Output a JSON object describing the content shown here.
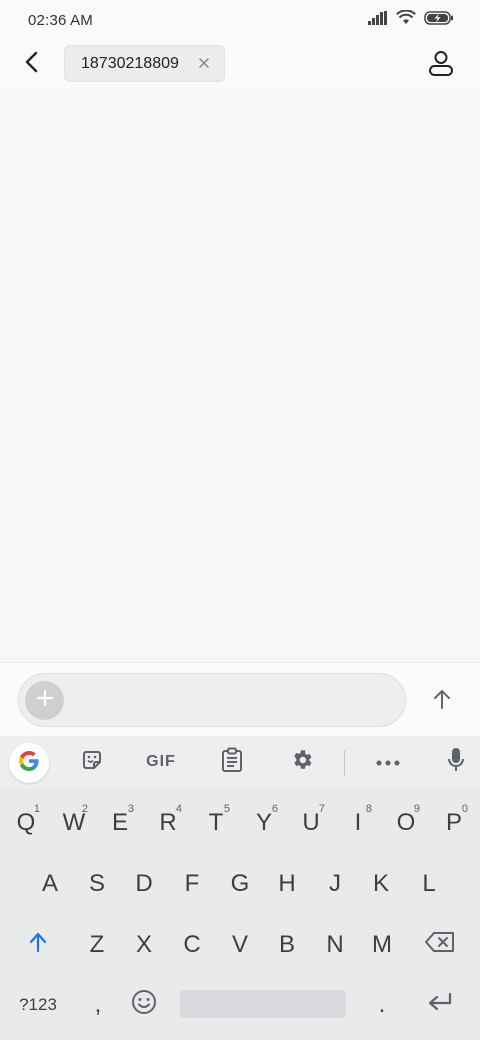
{
  "status_bar": {
    "time": "02:36 AM",
    "icons": [
      "signal-icon",
      "wifi-icon",
      "battery-charging-icon"
    ]
  },
  "header": {
    "back_icon": "back-arrow-icon",
    "recipient": "18730218809",
    "chip_close_icon": "close-icon",
    "contact_icon": "person-icon"
  },
  "compose": {
    "attach_icon": "plus-icon",
    "send_icon": "arrow-up-icon",
    "placeholder": ""
  },
  "keyboard": {
    "toolbar": {
      "google": "google-icon",
      "sticker": "sticker-icon",
      "gif_label": "GIF",
      "clipboard": "clipboard-icon",
      "settings": "gear-icon",
      "more": "more-icon",
      "mic": "mic-icon"
    },
    "row1": [
      {
        "key": "Q",
        "num": "1"
      },
      {
        "key": "W",
        "num": "2"
      },
      {
        "key": "E",
        "num": "3"
      },
      {
        "key": "R",
        "num": "4"
      },
      {
        "key": "T",
        "num": "5"
      },
      {
        "key": "Y",
        "num": "6"
      },
      {
        "key": "U",
        "num": "7"
      },
      {
        "key": "I",
        "num": "8"
      },
      {
        "key": "O",
        "num": "9"
      },
      {
        "key": "P",
        "num": "0"
      }
    ],
    "row2": [
      "A",
      "S",
      "D",
      "F",
      "G",
      "H",
      "J",
      "K",
      "L"
    ],
    "row3": [
      "Z",
      "X",
      "C",
      "V",
      "B",
      "N",
      "M"
    ],
    "shift_icon": "shift-icon",
    "backspace_icon": "backspace-icon",
    "symbols_label": "?123",
    "comma": ",",
    "emoji_icon": "emoji-icon",
    "period": ".",
    "enter_icon": "enter-icon"
  },
  "colors": {
    "shift_accent": "#1a73e8",
    "key_text": "#3c4043",
    "keyboard_bg": "#e9eaec"
  }
}
